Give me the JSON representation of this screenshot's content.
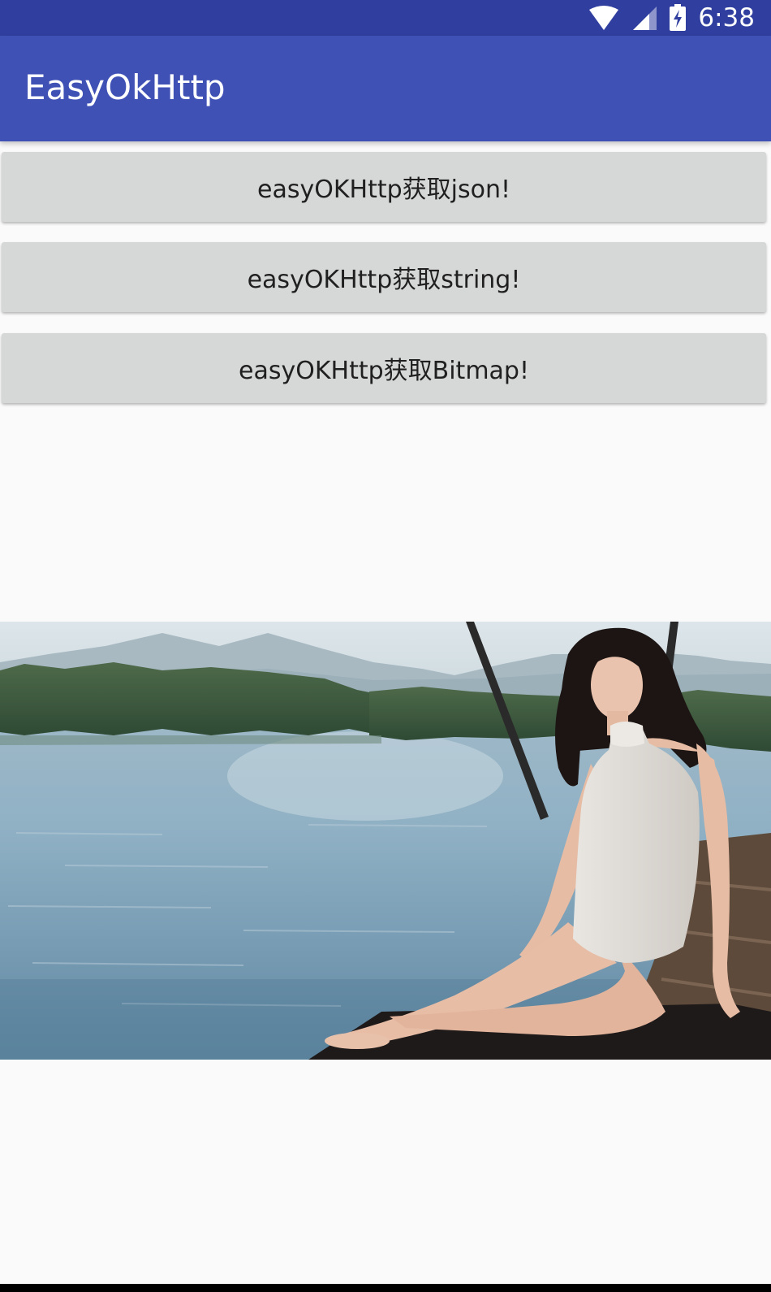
{
  "status_bar": {
    "time": "6:38",
    "icons": [
      "wifi-icon",
      "cell-signal-icon",
      "battery-charging-icon"
    ]
  },
  "app_bar": {
    "title": "EasyOkHttp"
  },
  "buttons": {
    "json_label": "easyOKHttp获取json!",
    "string_label": "easyOKHttp获取string!",
    "bitmap_label": "easyOKHttp获取Bitmap!"
  },
  "loaded_image": {
    "icon": "photo-woman-lakeside-pier"
  },
  "colors": {
    "status_bar": "#303f9f",
    "app_bar": "#3f51b5",
    "button": "#d6d7d7",
    "background": "#fafafa"
  }
}
